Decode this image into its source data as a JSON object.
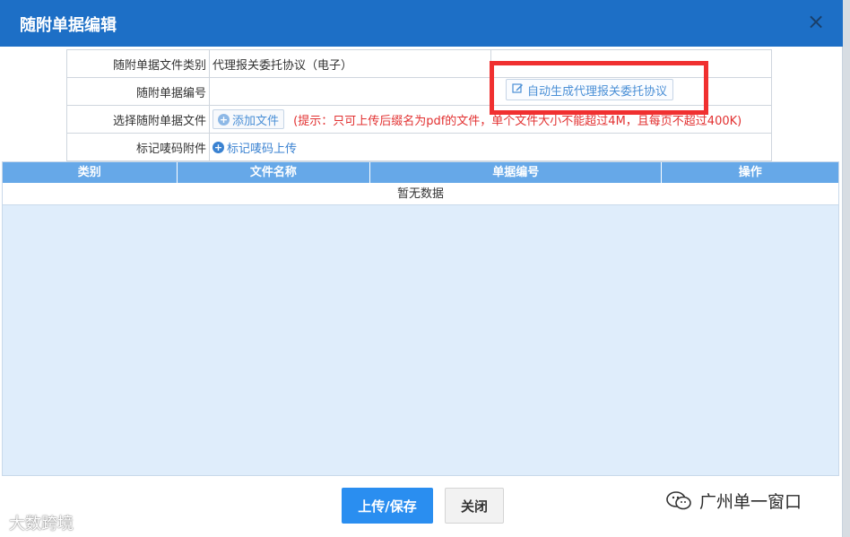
{
  "dialog": {
    "title": "随附单据编辑",
    "close_glyph": "×"
  },
  "form": {
    "row1": {
      "label": "随附单据文件类别",
      "value": "代理报关委托协议（电子）"
    },
    "row2": {
      "label": "随附单据编号",
      "auto_button": "自动生成代理报关委托协议"
    },
    "row3": {
      "label": "选择随附单据文件",
      "add_button": "添加文件",
      "hint": "(提示：只可上传后缀名为pdf的文件，单个文件大小不能超过4M，且每页不超过400K)"
    },
    "row4": {
      "label": "标记唛码附件",
      "upload_link": "标记唛码上传"
    }
  },
  "grid": {
    "columns": [
      "类别",
      "文件名称",
      "单据编号",
      "操作"
    ],
    "empty_text": "暂无数据"
  },
  "footer": {
    "save_label": "上传/保存",
    "close_label": "关闭"
  },
  "watermarks": {
    "left": "大数跨境",
    "right": "广州单一窗口"
  },
  "icons": {
    "edit": "edit-icon",
    "plus": "plus-circle-icon",
    "wechat": "wechat-icon"
  },
  "colors": {
    "titlebar": "#1d6fc6",
    "grid_header": "#66a8e8",
    "grid_body": "#dfedfb",
    "primary_button": "#2a8ef0",
    "highlight_box": "#f03030",
    "hint_text": "#e23030"
  }
}
